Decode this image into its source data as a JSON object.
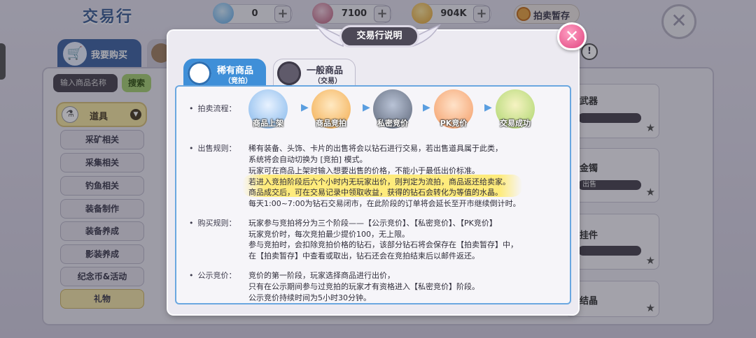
{
  "window_title": "交易行",
  "currencies": [
    {
      "name": "diamond",
      "value": "0",
      "color": "#5aa8e6"
    },
    {
      "name": "crystal",
      "value": "7100",
      "color": "#b95a78"
    },
    {
      "name": "gold",
      "value": "904K",
      "color": "#e3a22e"
    }
  ],
  "pause_button": "拍卖暂存",
  "tabs": {
    "buy": "我要购买"
  },
  "search": {
    "placeholder": "输入商品名称",
    "button": "搜索"
  },
  "category": {
    "main": "道具",
    "items": [
      "采矿相关",
      "采集相关",
      "钓鱼相关",
      "装备制作",
      "装备养成",
      "影装养成",
      "纪念币&活动",
      "礼物"
    ]
  },
  "cards": [
    {
      "name": "武器",
      "bar": ""
    },
    {
      "name": "金镯",
      "bar": "出售"
    },
    {
      "name": "挂件",
      "bar": ""
    },
    {
      "name": "结晶",
      "bar": ""
    }
  ],
  "modal": {
    "title": "交易行说明",
    "tabs": [
      {
        "title": "稀有商品",
        "sub": "（竞拍）"
      },
      {
        "title": "一般商品",
        "sub": "（交易）"
      }
    ],
    "flow_label": "拍卖流程：",
    "steps": [
      "商品上架",
      "商品竞拍",
      "私密竞价",
      "PK竞价",
      "交易成功"
    ],
    "sell_label": "出售规则：",
    "sell_lines": [
      "稀有装备、头饰、卡片的出售将会以钻石进行交易，若出售道具属于此类，",
      "系统将会自动切换为 [竞拍] 模式。",
      "玩家可在商品上架时输入想要出售的价格，不能小于最低出价标准。",
      "若进入竞拍阶段后六个小时内无玩家出价，则判定为流拍，商品返还给卖家。",
      "商品成交后，可在交易记录中领取收益，获得的钻石会转化为等值的水晶。",
      "每天1:00~7:00为钻石交易闭市，在此阶段的订单将会延长至开市继续倒计时。"
    ],
    "buy_label": "购买规则：",
    "buy_lines": [
      "玩家参与竞拍将分为三个阶段——【公示竞价】、【私密竞价】、【PK竞价】",
      "玩家竞价时，每次竞拍最少提价100，无上限。",
      "参与竞拍时，会扣除竞拍价格的钻石，该部分钻石将会保存在【拍卖暂存】中，",
      "在【拍卖暂存】中查看或取出，钻石还会在竞拍结束后以邮件返还。"
    ],
    "public_label": "公示竞价：",
    "public_lines": [
      "竞价的第一阶段，玩家选择商品进行出价，",
      "只有在公示期间参与过竞拍的玩家才有资格进入【私密竞价】阶段。",
      "公示竞价持续时间为5小时30分钟。"
    ]
  }
}
